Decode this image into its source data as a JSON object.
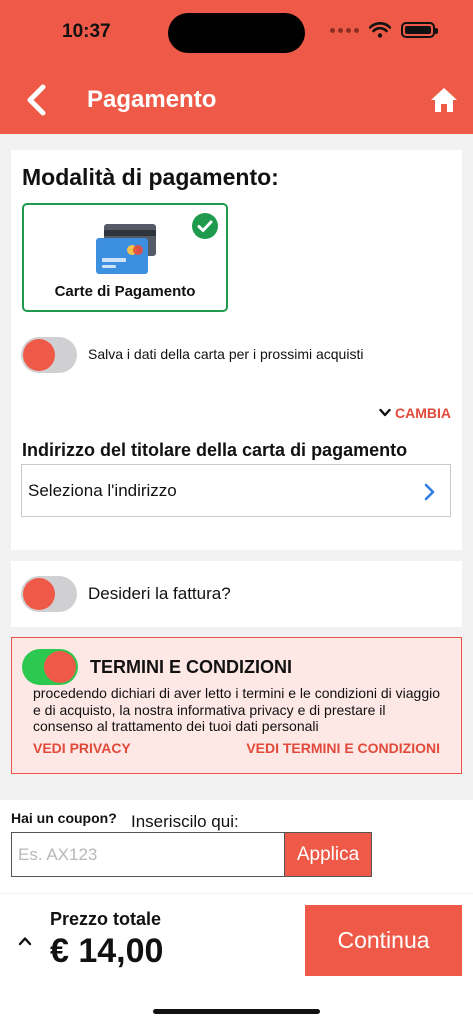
{
  "status_bar": {
    "time": "10:37"
  },
  "header": {
    "title": "Pagamento"
  },
  "payment": {
    "section_title": "Modalità di pagamento:",
    "method_label": "Carte di Pagamento",
    "save_card_label": "Salva i dati della carta per i prossimi acquisti",
    "save_card_on": false,
    "change_label": "CAMBIA",
    "address_title": "Indirizzo del titolare della carta di pagamento",
    "address_placeholder": "Seleziona l'indirizzo"
  },
  "invoice": {
    "label": "Desideri la fattura?",
    "on": false
  },
  "terms": {
    "title": "TERMINI E CONDIZIONI",
    "on": true,
    "text": "procedendo dichiari di aver letto i termini e le condizioni di viaggio e di acquisto, la nostra informativa privacy e di prestare il consenso al trattamento dei tuoi dati personali",
    "privacy_link": "VEDI PRIVACY",
    "terms_link": "VEDI TERMINI E CONDIZIONI"
  },
  "coupon": {
    "question": "Hai un coupon?",
    "hint": "Inseriscilo qui:",
    "placeholder": "Es. AX123",
    "value": "",
    "apply_label": "Applica"
  },
  "total": {
    "label": "Prezzo totale",
    "value": "€ 14,00",
    "continue_label": "Continua"
  },
  "colors": {
    "accent": "#ef5a48",
    "success": "#1f9b4d",
    "toggle_on": "#2cc84f",
    "terms_bg": "#fde8e6"
  }
}
